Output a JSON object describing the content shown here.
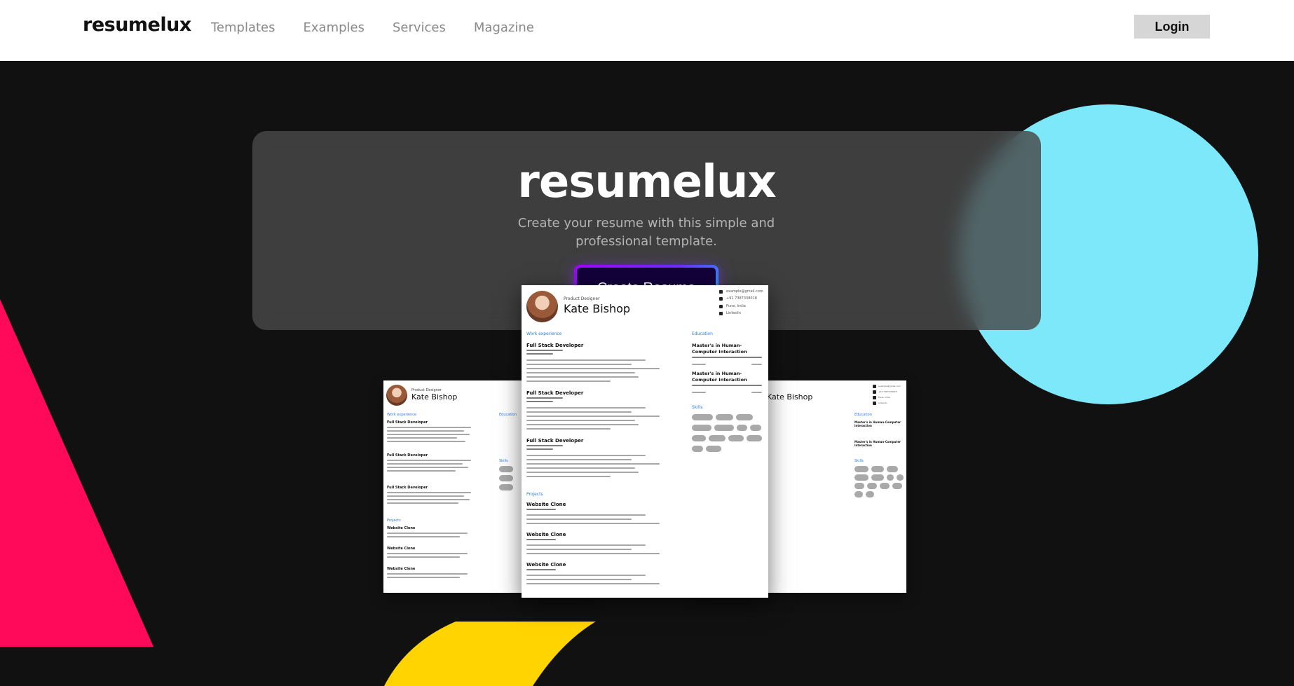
{
  "nav": {
    "brand": "resumelux",
    "links": [
      "Templates",
      "Examples",
      "Services",
      "Magazine"
    ],
    "login": "Login"
  },
  "hero": {
    "title": "resumelux",
    "subtitle": "Create your resume with this simple and professional template.",
    "cta": "Create Resume"
  },
  "resume_preview": {
    "role": "Product Designer",
    "name": "Kate Bishop",
    "contacts": [
      "example@gmail.com",
      "+91 7387338018",
      "Pune, India",
      "Linkedin"
    ],
    "sections": {
      "work": "Work experience",
      "education": "Education",
      "skills": "Skills",
      "projects": "Projects"
    },
    "jobs": [
      "Full Stack Developer",
      "Full Stack Developer",
      "Full Stack Developer"
    ],
    "degrees": [
      "Master's in Human-Computer Interaction",
      "Master's in Human-Computer Interaction"
    ],
    "projects": [
      "Website Clone",
      "Website Clone",
      "Website Clone"
    ]
  },
  "colors": {
    "background": "#111111",
    "circle": "#7de8f9",
    "triangle": "#ff0a5a",
    "accent_yellow": "#ffd400",
    "cta_gradient_start": "#a400ff",
    "cta_gradient_end": "#16b6ff"
  }
}
